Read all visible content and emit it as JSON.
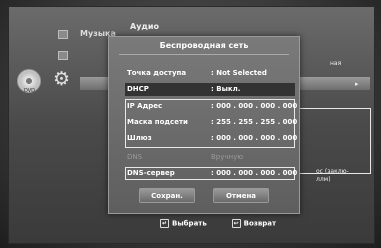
{
  "background": {
    "category": "Аудио",
    "music_label": "Музыка",
    "disc_label": "DVD",
    "right_text_1": "ная",
    "right_text_2": "ос (заклю-",
    "right_text_3": "ллм)"
  },
  "dialog": {
    "title": "Беспроводная сеть",
    "rows": [
      {
        "label": "Точка доступа",
        "value": ":   Not Selected"
      },
      {
        "label": "DHCP",
        "value": ": Выкл."
      },
      {
        "label": "IP Адрес",
        "value": ": 000 . 000 . 000 . 000"
      },
      {
        "label": "Маска подсети",
        "value": ": 255 . 255 . 255 . 000"
      },
      {
        "label": "Шлюз",
        "value": ": 000 . 000 . 000 . 000"
      },
      {
        "label": "DNS",
        "value": "   Вручную"
      },
      {
        "label": "DNS-сервер",
        "value": ": 000 . 000 . 000 . 000"
      }
    ],
    "save_label": "Сохран.",
    "cancel_label": "Отмена"
  },
  "footer": {
    "select_label": "Выбрать",
    "return_label": "Возврат"
  }
}
